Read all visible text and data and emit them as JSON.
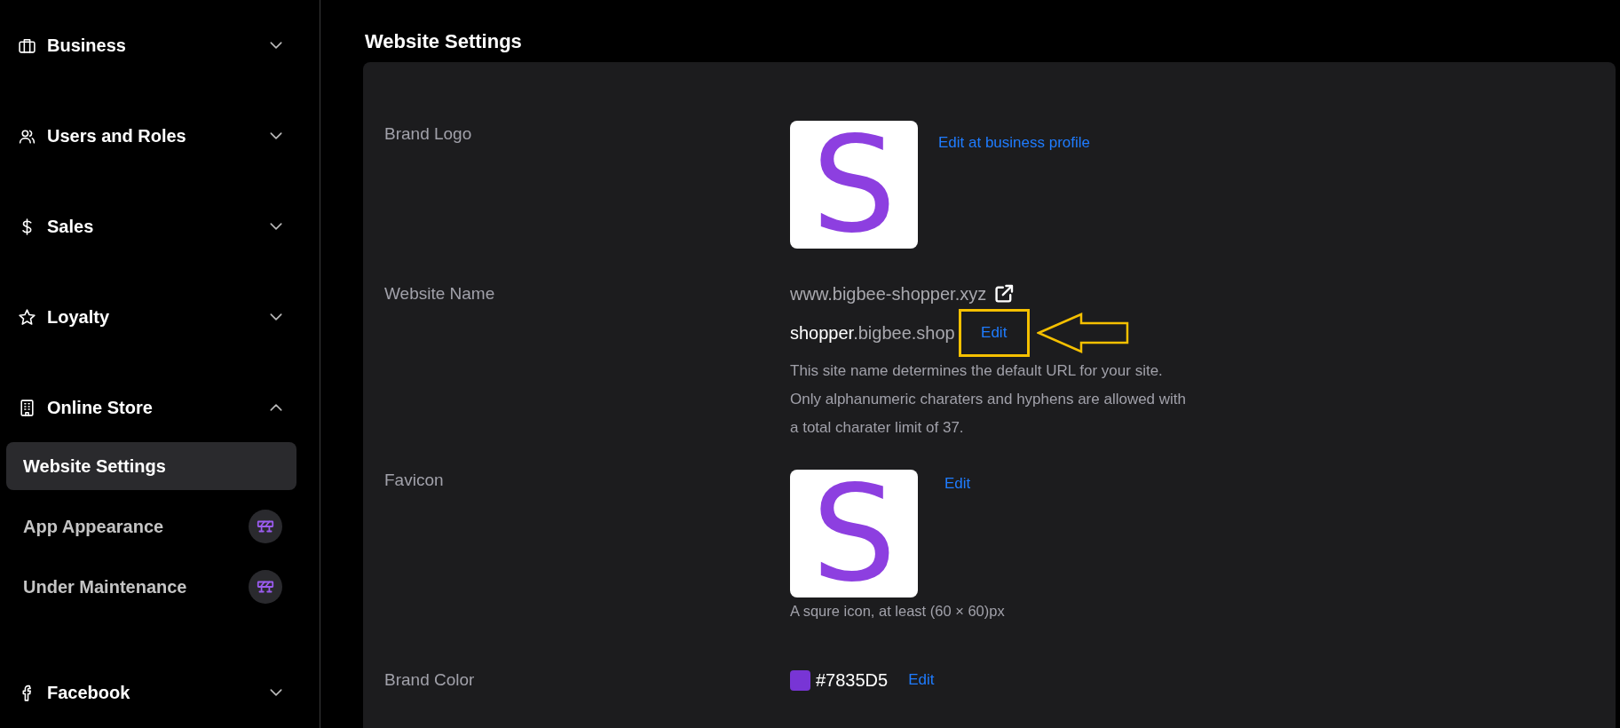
{
  "sidebar": {
    "groups": [
      {
        "label": "Business",
        "expanded": false
      },
      {
        "label": "Users and Roles",
        "expanded": false
      },
      {
        "label": "Sales",
        "expanded": false
      },
      {
        "label": "Loyalty",
        "expanded": false
      },
      {
        "label": "Online Store",
        "expanded": true,
        "children": [
          {
            "label": "Website Settings",
            "selected": true,
            "badge": false
          },
          {
            "label": "App Appearance",
            "selected": false,
            "badge": true
          },
          {
            "label": "Under Maintenance",
            "selected": false,
            "badge": true
          }
        ]
      },
      {
        "label": "Facebook",
        "expanded": false
      }
    ]
  },
  "page": {
    "title": "Website Settings"
  },
  "settings": {
    "brand_logo": {
      "label": "Brand Logo",
      "letter": "S",
      "link": "Edit at business profile"
    },
    "website_name": {
      "label": "Website Name",
      "url": "www.bigbee-shopper.xyz",
      "subdomain": "shopper",
      "domain": ".bigbee.shop",
      "edit": "Edit",
      "highlighted": true,
      "description": "This site name determines the default URL for your site. Only alphanumeric charaters and hyphens are allowed with a total charater limit of 37."
    },
    "favicon": {
      "label": "Favicon",
      "letter": "S",
      "edit": "Edit",
      "caption": "A squre icon, at least (60 × 60)px"
    },
    "brand_color": {
      "label": "Brand Color",
      "color": "#7835d5",
      "value": "#7835D5",
      "edit": "Edit"
    }
  }
}
